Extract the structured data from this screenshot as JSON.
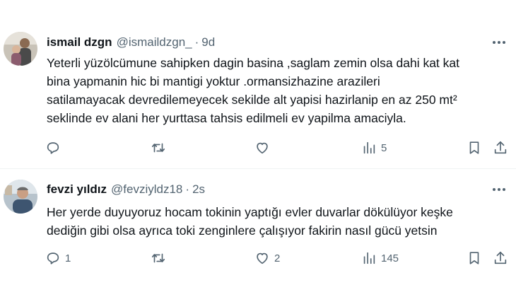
{
  "tweets": [
    {
      "name": "ismail dzgn",
      "handle": "@ismaildzgn_",
      "separator": "·",
      "time": "9d",
      "text_lines": [
        "Yeterli yüzölcümune sahipken dagin basina ,saglam zemin olsa dahi kat kat",
        "bina yapmanin hic bi mantigi yoktur .ormansizhazine arazileri",
        "satilamayacak devredilemeyecek sekilde alt yapisi hazirlanip en az 250 mt²",
        "seklinde ev alani her yurttasa tahsis edilmeli ev yapilma amaciyla."
      ],
      "counts": {
        "replies": "",
        "retweets": "",
        "likes": "",
        "views": "5"
      }
    },
    {
      "name": "fevzi yıldız",
      "handle": "@fevziyldz18",
      "separator": "·",
      "time": "2s",
      "text_lines": [
        "Her yerde duyuyoruz hocam tokinin yaptığı evler duvarlar dökülüyor keşke",
        "dediğin gibi olsa ayrıca toki zenginlere çalışıyor fakirin nasıl gücü yetsin"
      ],
      "counts": {
        "replies": "1",
        "retweets": "",
        "likes": "2",
        "views": "145"
      }
    }
  ],
  "icons": {
    "more": "more-dots-icon",
    "reply": "reply-icon",
    "retweet": "retweet-icon",
    "like": "heart-icon",
    "views": "views-chart-icon",
    "bookmark": "bookmark-icon",
    "share": "share-icon"
  },
  "colors": {
    "text": "#0f1419",
    "secondary": "#536471",
    "divider": "#eff3f4"
  }
}
